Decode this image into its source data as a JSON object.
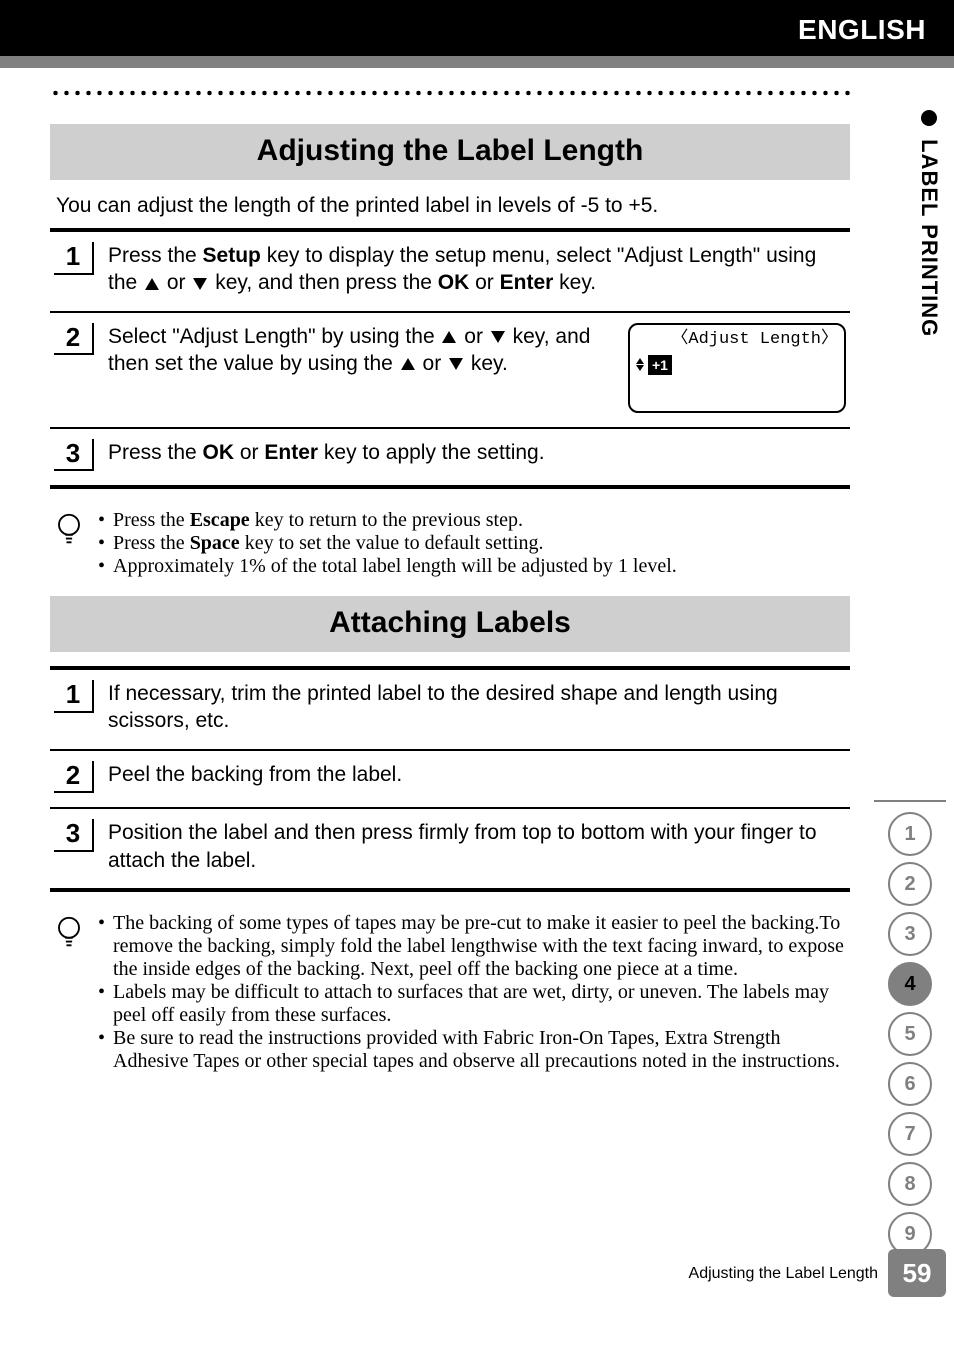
{
  "header": {
    "language": "ENGLISH"
  },
  "sidebar": {
    "chapter": "LABEL PRINTING",
    "tabs": [
      "1",
      "2",
      "3",
      "4",
      "5",
      "6",
      "7",
      "8",
      "9"
    ],
    "active_tab_index": 3,
    "page_number": "59"
  },
  "footer": {
    "running_title": "Adjusting the Label Length"
  },
  "section1": {
    "title": "Adjusting the Label Length",
    "intro": "You can adjust the length of the printed label in levels of -5 to +5.",
    "steps": [
      {
        "num": "1",
        "pre": "Press the ",
        "k1": "Setup",
        "mid1": " key to display the setup menu, select \"Adjust Length\" using the ",
        "mid2": " or ",
        "mid3": " key, and then press the ",
        "k2": "OK",
        "mid4": " or ",
        "k3": "Enter",
        "post": " key."
      },
      {
        "num": "2",
        "pre": "Select \"Adjust Length\" by using the ",
        "mid1": " or ",
        "mid2": " key, and then set the value by using the ",
        "mid3": " or ",
        "post": " key.",
        "screen_title": "〈Adjust Length〉",
        "screen_value": "+1"
      },
      {
        "num": "3",
        "pre": "Press the ",
        "k1": "OK",
        "mid1": " or ",
        "k2": "Enter",
        "post": " key to apply the setting."
      }
    ],
    "notes": [
      {
        "pre": "Press the ",
        "k": "Escape",
        "post": " key to return to the previous step."
      },
      {
        "pre": "Press the ",
        "k": "Space",
        "post": " key to set the value to default setting."
      },
      {
        "plain": "Approximately 1% of the total label length will be adjusted by 1 level."
      }
    ]
  },
  "section2": {
    "title": "Attaching Labels",
    "steps": [
      {
        "num": "1",
        "text": "If necessary, trim the printed label to the desired shape and length using scissors, etc."
      },
      {
        "num": "2",
        "text": "Peel the backing from the label."
      },
      {
        "num": "3",
        "text": "Position the label and then press firmly from top to bottom with your finger to attach the label."
      }
    ],
    "notes": [
      "The backing of some types of tapes may be pre-cut to make it easier to peel the backing.To remove the backing, simply fold the label lengthwise with the text facing inward, to expose the inside edges of the backing. Next, peel off the backing one piece at a time.",
      "Labels may be difficult to attach to surfaces that are wet, dirty, or uneven. The labels may peel off easily from these surfaces.",
      "Be sure to read the instructions provided with Fabric Iron-On Tapes, Extra Strength Adhesive Tapes or other special tapes and observe all precautions noted in the instructions."
    ]
  }
}
